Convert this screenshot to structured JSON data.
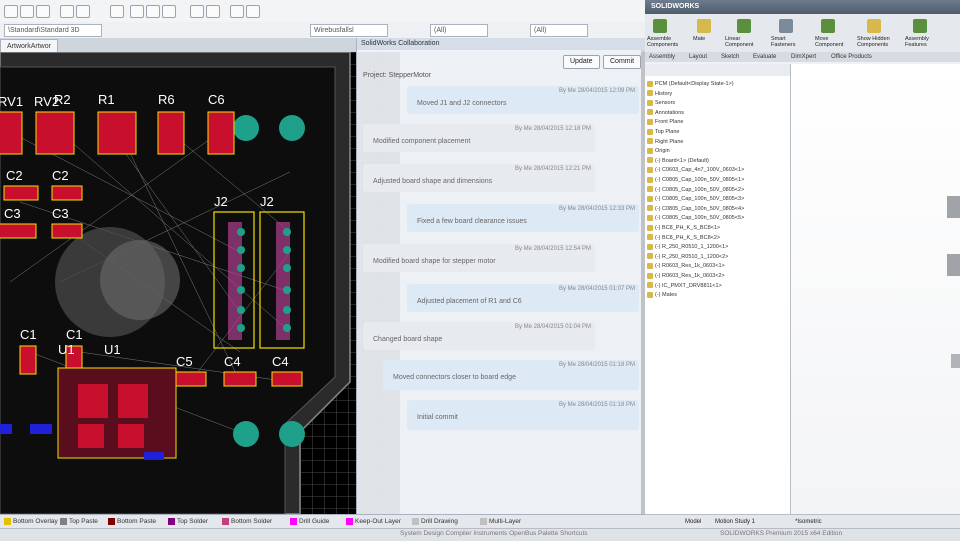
{
  "pcb": {
    "tab_label": "ArtworkArtwor",
    "combo_1": "\\Standard\\Standard 3D",
    "combo_2": "(All)",
    "combo_3": "(All)",
    "combo_4": "Wirebusfallsl",
    "designators": [
      "RV1",
      "RV2",
      "R2",
      "R1",
      "R6",
      "C6",
      "C2",
      "C2",
      "C3",
      "C3",
      "J2",
      "J2",
      "C1",
      "C1",
      "U1",
      "U1",
      "C5",
      "C4",
      "C4"
    ],
    "layers": [
      "Bottom Overlay",
      "Top Paste",
      "Bottom Paste",
      "Top Solder",
      "Bottom Solder",
      "Drill Guide",
      "Keep-Out Layer",
      "Drill Drawing",
      "Multi-Layer"
    ]
  },
  "colors": {
    "copper": "#c8102e",
    "silk": "#f5e000",
    "pad": "#1fa08a",
    "board_edge": "#8a8a8a",
    "via": "#2020d8"
  },
  "collab": {
    "title": "SolidWorks Collaboration",
    "project": "Project: StepperMotor",
    "update_button": "Update",
    "commit_button": "Commit",
    "entries": [
      {
        "side": "right",
        "meta": "By Me 28/04/2015 12:09 PM",
        "msg": "Moved J1 and J2 connectors"
      },
      {
        "side": "left",
        "meta": "By Me 28/04/2015 12:18 PM",
        "msg": "Modified component placement"
      },
      {
        "side": "left",
        "meta": "By Me 28/04/2015 12:21 PM",
        "msg": "Adjusted board shape and dimensions"
      },
      {
        "side": "right",
        "meta": "By Me 28/04/2015 12:33 PM",
        "msg": "Fixed a few board clearance issues"
      },
      {
        "side": "left",
        "meta": "By Me 28/04/2015 12:54 PM",
        "msg": "Modified board shape for stepper motor"
      },
      {
        "side": "right",
        "meta": "By Me 28/04/2015 01:07 PM",
        "msg": "Adjusted placement of R1 and C6"
      },
      {
        "side": "left",
        "meta": "By Me 28/04/2015 01:04 PM",
        "msg": "Changed board shape"
      },
      {
        "side": "right",
        "meta": "By Me 28/04/2015 01:18 PM",
        "msg": "Moved connectors closer to board edge"
      },
      {
        "side": "right",
        "meta": "By Me 28/04/2015 01:18 PM",
        "msg": "Initial commit"
      }
    ]
  },
  "solidworks": {
    "title": "SOLIDWORKS",
    "ribbon_labels": [
      "Assemble Components",
      "Mate",
      "Linear Component",
      "Smart Fasteners",
      "Move Component",
      "Show Hidden Components",
      "Assembly Features"
    ],
    "tabs": [
      "Assembly",
      "Layout",
      "Sketch",
      "Evaluate",
      "DimXpert",
      "Office Products"
    ],
    "tree": [
      "PCM (Default<Display State-1>)",
      "History",
      "Sensors",
      "Annotations",
      "Front Plane",
      "Top Plane",
      "Right Plane",
      "Origin",
      "(-) Board<1> (Default)",
      "(-) C0603_Cap_4n7_100V_0603<1>",
      "(-) C0805_Cap_100n_50V_0805<1>",
      "(-) C0805_Cap_100n_50V_0805<2>",
      "(-) C0805_Cap_100n_50V_0805<3>",
      "(-) C0805_Cap_100n_50V_0805<4>",
      "(-) C0805_Cap_100n_50V_0805<5>",
      "(-) BC8_PH_K_S_BC8<1>",
      "(-) BC8_PH_K_S_BC8<2>",
      "(-) R_250_R0510_1_1200<1>",
      "(-) R_250_R0510_1_1200<2>",
      "(-) R0603_Res_1k_0603<1>",
      "(-) R0603_Res_1k_0603<2>",
      "(-) IC_PMXT_DRV8811<1>",
      "(-) Mates"
    ],
    "bottom_tabs": [
      "Model",
      "Motion Study 1"
    ],
    "view_label": "*Isometric"
  },
  "status": {
    "left": "System Design Compiler Instruments OpenBus Palette Shortcuts",
    "right": "SOLIDWORKS Premium 2015 x64 Edition"
  }
}
